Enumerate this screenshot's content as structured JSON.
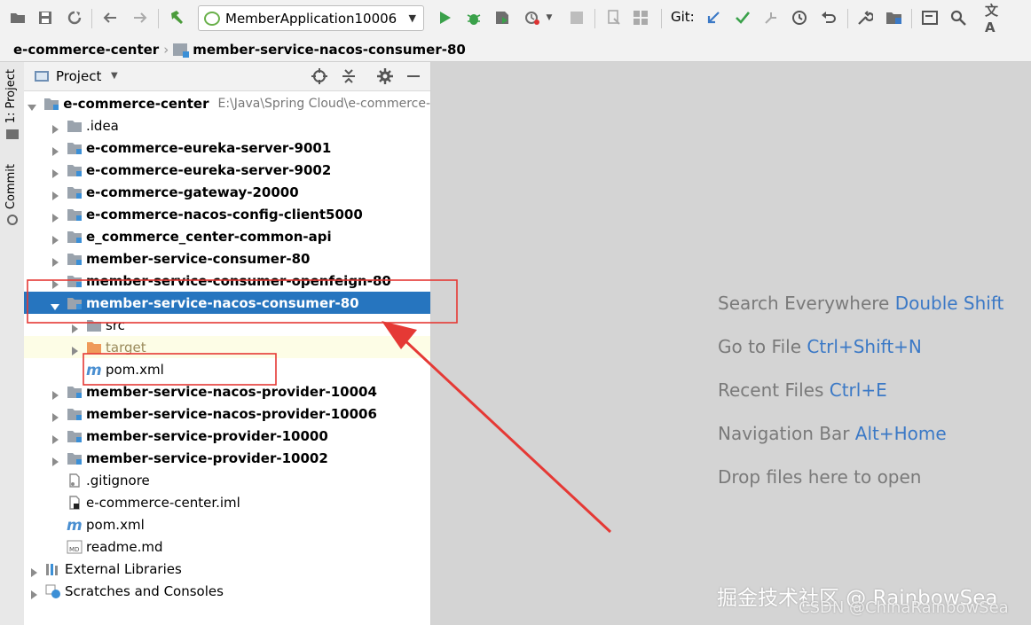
{
  "toolbar": {
    "run_config": "MemberApplication10006",
    "git_label": "Git:",
    "icons": [
      "open-folder-icon",
      "save-icon",
      "sync-icon",
      "back-icon",
      "forward-icon",
      "build-icon",
      "run-icon",
      "debug-icon",
      "coverage-icon",
      "profile-icon",
      "stop-icon",
      "attach-icon",
      "project-structure-icon",
      "git-update-icon",
      "git-commit-icon",
      "git-push-icon",
      "history-icon",
      "rollback-icon",
      "settings-icon",
      "sdk-icon",
      "terminal-icon",
      "search-icon",
      "translate-icon"
    ]
  },
  "breadcrumb": {
    "root": "e-commerce-center",
    "module": "member-service-nacos-consumer-80"
  },
  "side_strip": {
    "project_tab": "1: Project",
    "commit_tab": "Commit"
  },
  "project_panel": {
    "title": "Project",
    "rows": [
      {
        "label": "e-commerce-center",
        "path": "E:\\Java\\Spring Cloud\\e-commerce-",
        "level": 0,
        "arrow": "down",
        "icon": "module-folder",
        "bold": true
      },
      {
        "label": ".idea",
        "level": 1,
        "arrow": "right",
        "icon": "folder",
        "bold": false
      },
      {
        "label": "e-commerce-eureka-server-9001",
        "level": 1,
        "arrow": "right",
        "icon": "module-folder",
        "bold": true
      },
      {
        "label": "e-commerce-eureka-server-9002",
        "level": 1,
        "arrow": "right",
        "icon": "module-folder",
        "bold": true
      },
      {
        "label": "e-commerce-gateway-20000",
        "level": 1,
        "arrow": "right",
        "icon": "module-folder",
        "bold": true
      },
      {
        "label": "e-commerce-nacos-config-client5000",
        "level": 1,
        "arrow": "right",
        "icon": "module-folder",
        "bold": true
      },
      {
        "label": "e_commerce_center-common-api",
        "level": 1,
        "arrow": "right",
        "icon": "module-folder",
        "bold": true
      },
      {
        "label": "member-service-consumer-80",
        "level": 1,
        "arrow": "right",
        "icon": "module-folder",
        "bold": true
      },
      {
        "label": "member-service-consumer-openfeign-80",
        "level": 1,
        "arrow": "right",
        "icon": "module-folder",
        "bold": true
      },
      {
        "label": "member-service-nacos-consumer-80",
        "level": 1,
        "arrow": "down",
        "icon": "module-folder",
        "bold": true,
        "selected": true
      },
      {
        "label": "src",
        "level": 2,
        "arrow": "right",
        "icon": "folder",
        "bold": false
      },
      {
        "label": "target",
        "level": 2,
        "arrow": "right",
        "icon": "orange-folder",
        "bold": false,
        "muted": true,
        "highlight": true
      },
      {
        "label": "pom.xml",
        "level": 2,
        "arrow": "none",
        "icon": "maven",
        "bold": false
      },
      {
        "label": "member-service-nacos-provider-10004",
        "level": 1,
        "arrow": "right",
        "icon": "module-folder",
        "bold": true
      },
      {
        "label": "member-service-nacos-provider-10006",
        "level": 1,
        "arrow": "right",
        "icon": "module-folder",
        "bold": true
      },
      {
        "label": "member-service-provider-10000",
        "level": 1,
        "arrow": "right",
        "icon": "module-folder",
        "bold": true
      },
      {
        "label": "member-service-provider-10002",
        "level": 1,
        "arrow": "right",
        "icon": "module-folder",
        "bold": true
      },
      {
        "label": ".gitignore",
        "level": 1,
        "arrow": "none",
        "icon": "file",
        "bold": false
      },
      {
        "label": "e-commerce-center.iml",
        "level": 1,
        "arrow": "none",
        "icon": "iml",
        "bold": false
      },
      {
        "label": "pom.xml",
        "level": 1,
        "arrow": "none",
        "icon": "maven",
        "bold": false
      },
      {
        "label": "readme.md",
        "level": 1,
        "arrow": "none",
        "icon": "md",
        "bold": false
      },
      {
        "label": "External Libraries",
        "level": 0,
        "arrow": "right",
        "icon": "libraries",
        "bold": false
      },
      {
        "label": "Scratches and Consoles",
        "level": 0,
        "arrow": "right",
        "icon": "scratches",
        "bold": false
      }
    ]
  },
  "editor_hints": [
    {
      "text": "Search Everywhere ",
      "key": "Double Shift"
    },
    {
      "text": "Go to File ",
      "key": "Ctrl+Shift+N"
    },
    {
      "text": "Recent Files ",
      "key": "Ctrl+E"
    },
    {
      "text": "Navigation Bar ",
      "key": "Alt+Home"
    },
    {
      "text": "Drop files here to open",
      "key": ""
    }
  ],
  "watermark": {
    "line1": "掘金技术社区 @ RainbowSea",
    "line2": "CSDN @ChinaRainbowSea"
  },
  "colors": {
    "selection": "#2675bf",
    "annotation": "#e53935",
    "hint_key": "#3b79c6"
  }
}
